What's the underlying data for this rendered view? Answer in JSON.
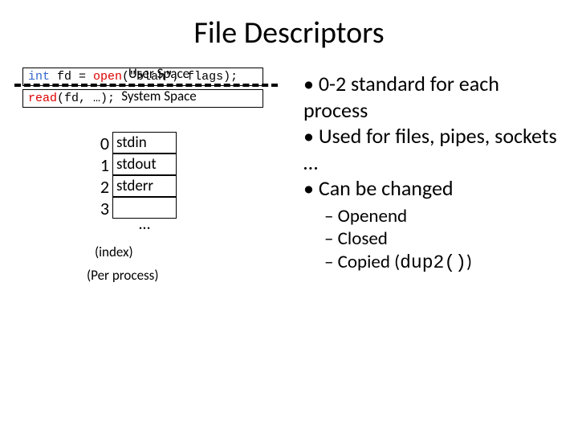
{
  "title": "File Descriptors",
  "code": {
    "line1": {
      "kw_int": "int",
      "var": " fd = ",
      "fn": "open",
      "rest": "(\"blah\", flags);"
    },
    "line2": {
      "fn": "read",
      "rest": "(fd, …);"
    }
  },
  "labels": {
    "user_space": "User Space",
    "system_space": "System Space",
    "index": "(index)",
    "per_process": "(Per process)"
  },
  "fd_table": [
    {
      "idx": "0",
      "name": "stdin"
    },
    {
      "idx": "1",
      "name": "stdout"
    },
    {
      "idx": "2",
      "name": "stderr"
    },
    {
      "idx": "3",
      "name": ""
    }
  ],
  "fd_dots": "…",
  "bullets": {
    "b1": "0-2 standard for each process",
    "b2": "Used for files, pipes, sockets …",
    "b3": "Can be changed",
    "sub1": "Openend",
    "sub2": "Closed",
    "sub3_pre": "Copied (",
    "sub3_code": "dup2()",
    "sub3_post": ")"
  }
}
